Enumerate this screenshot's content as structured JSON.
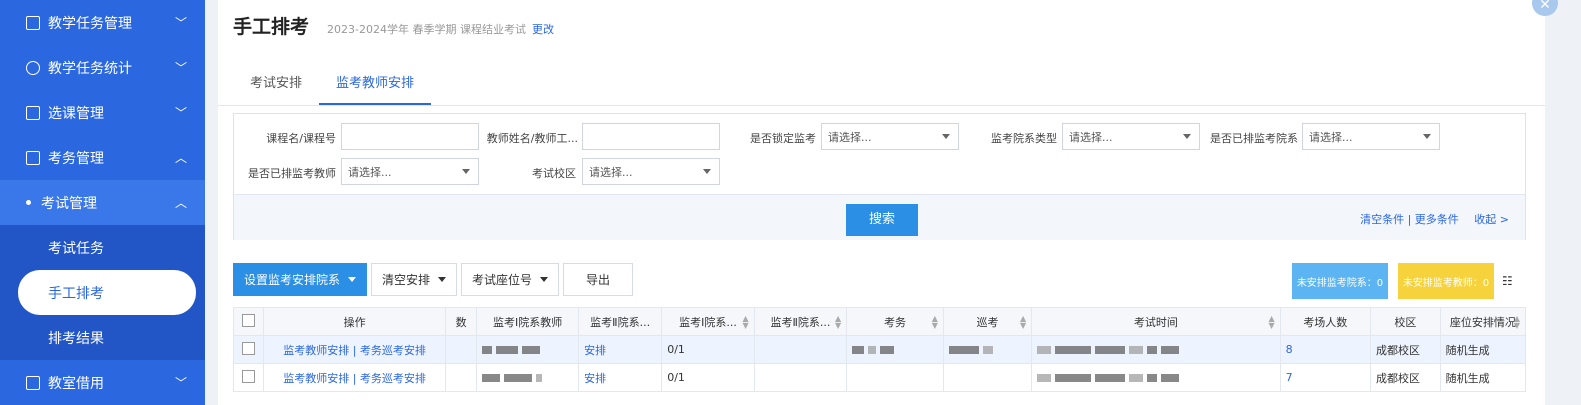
{
  "sidebar": {
    "items": [
      {
        "label": "教学任务管理"
      },
      {
        "label": "教学任务统计"
      },
      {
        "label": "选课管理"
      },
      {
        "label": "考务管理"
      },
      {
        "label": "考试管理"
      },
      {
        "label": "考试任务"
      },
      {
        "label": "手工排考"
      },
      {
        "label": "排考结果"
      },
      {
        "label": "教室借用"
      }
    ]
  },
  "header": {
    "title": "手工排考",
    "subtitle": "2023-2024学年 春季学期 课程结业考试",
    "change": "更改"
  },
  "tabs": [
    {
      "label": "考试安排"
    },
    {
      "label": "监考教师安排"
    }
  ],
  "filters": {
    "course_label": "课程名/课程号",
    "teacher_label": "教师姓名/教师工...",
    "locked_label": "是否锁定监考",
    "dept_type_label": "监考院系类型",
    "dept_arranged_label": "是否已排监考院系",
    "teacher_arranged_label": "是否已排监考教师",
    "campus_label": "考试校区",
    "placeholder": "请选择..."
  },
  "actions": {
    "search": "搜索",
    "links": "清空条件 | 更多条件",
    "collapse": "收起 >"
  },
  "toolbar": {
    "set_dept": "设置监考安排院系",
    "clear": "清空安排",
    "seat": "考试座位号",
    "export": "导出"
  },
  "badges": {
    "unarranged_dept": "未安排监考院系：0",
    "unarranged_teacher": "未安排监考教师：0"
  },
  "table": {
    "columns": [
      "操作",
      "数",
      "监考Ⅰ院系教师",
      "监考Ⅱ院系...",
      "监考Ⅰ院系...",
      "监考Ⅱ院系...",
      "考务",
      "巡考",
      "考试时间",
      "考场人数",
      "校区",
      "座位安排情况"
    ],
    "rows": [
      {
        "op": "监考教师安排 | 考务巡考安排",
        "arrange": "安排",
        "ratio": "0/1",
        "count": "8",
        "campus": "成都校区",
        "seat": "随机生成"
      },
      {
        "op": "监考教师安排 | 考务巡考安排",
        "arrange": "安排",
        "ratio": "0/1",
        "count": "7",
        "campus": "成都校区",
        "seat": "随机生成"
      }
    ]
  },
  "colors": {
    "primary": "#2b68e0",
    "button": "#2b8fe6",
    "badge_blue": "#5cb5f2",
    "badge_yellow": "#f6d23c"
  }
}
